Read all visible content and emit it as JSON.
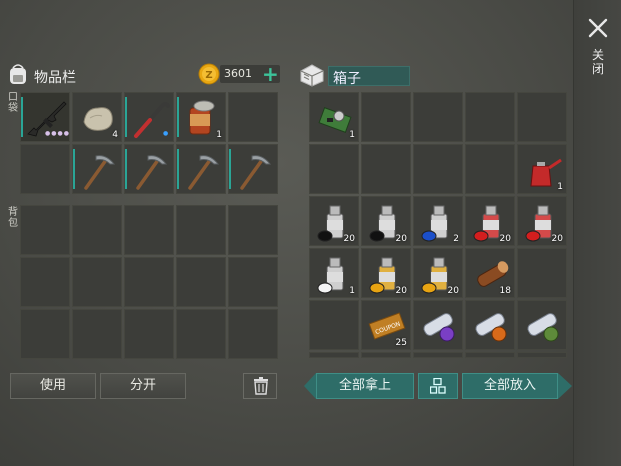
{
  "inventory": {
    "title": "物品栏",
    "coins": "3601",
    "pocket_label": "口袋",
    "backpack_label": "背包",
    "pocket_row1": [
      {
        "item": "assault-rifle-icon",
        "qty": ""
      },
      {
        "item": "stone-icon",
        "qty": "4"
      },
      {
        "item": "crowbar-icon",
        "qty": ""
      },
      {
        "item": "food-can-icon",
        "qty": "1"
      },
      {
        "item": "",
        "qty": ""
      }
    ],
    "pocket_row2": [
      {
        "item": "",
        "qty": ""
      },
      {
        "item": "pickaxe-icon",
        "qty": ""
      },
      {
        "item": "pickaxe-icon",
        "qty": ""
      },
      {
        "item": "pickaxe-icon",
        "qty": ""
      },
      {
        "item": "pickaxe-icon",
        "qty": ""
      }
    ]
  },
  "box": {
    "title": "箱子",
    "slots": [
      [
        {
          "item": "circuit-board-icon",
          "qty": "1"
        },
        {
          "item": "",
          "qty": ""
        },
        {
          "item": "",
          "qty": ""
        },
        {
          "item": "",
          "qty": ""
        },
        {
          "item": "",
          "qty": ""
        }
      ],
      [
        {
          "item": "",
          "qty": ""
        },
        {
          "item": "",
          "qty": ""
        },
        {
          "item": "",
          "qty": ""
        },
        {
          "item": "",
          "qty": ""
        },
        {
          "item": "oil-can-icon",
          "qty": "1"
        }
      ],
      [
        {
          "item": "spray-black-icon",
          "qty": "20"
        },
        {
          "item": "spray-black-icon",
          "qty": "20"
        },
        {
          "item": "spray-blue-icon",
          "qty": "2"
        },
        {
          "item": "spray-red-icon",
          "qty": "20"
        },
        {
          "item": "spray-red-icon",
          "qty": "20"
        }
      ],
      [
        {
          "item": "spray-white-icon",
          "qty": "1"
        },
        {
          "item": "spray-yellow-icon",
          "qty": "20"
        },
        {
          "item": "spray-yellow-icon",
          "qty": "20"
        },
        {
          "item": "log-icon",
          "qty": "18"
        },
        {
          "item": "",
          "qty": ""
        }
      ],
      [
        {
          "item": "",
          "qty": ""
        },
        {
          "item": "coupon-icon",
          "qty": "25"
        },
        {
          "item": "blueprint-purple-icon",
          "qty": ""
        },
        {
          "item": "blueprint-orange-icon",
          "qty": ""
        },
        {
          "item": "blueprint-green-icon",
          "qty": ""
        }
      ]
    ]
  },
  "buttons": {
    "use": "使用",
    "split": "分开",
    "take_all": "全部拿上",
    "put_all": "全部放入",
    "close": "关闭"
  },
  "colors": {
    "accent": "#2e6d68",
    "coin": "#e8a712",
    "plus": "#3dc39a"
  }
}
